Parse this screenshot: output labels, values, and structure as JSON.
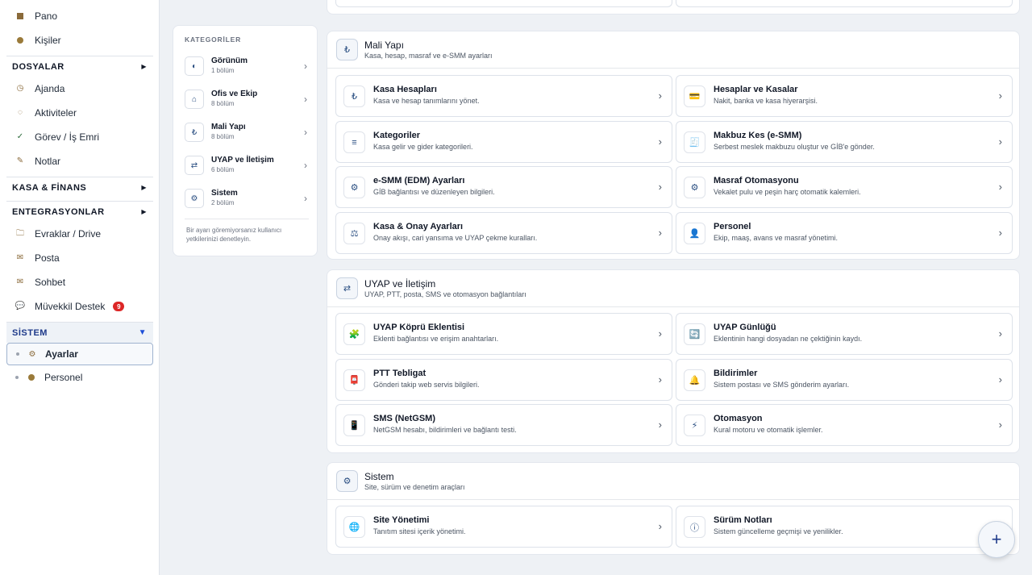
{
  "sidebar": {
    "items_top": [
      {
        "label": "Pano",
        "icon": "dashboard-icon"
      },
      {
        "label": "Kişiler",
        "icon": "contacts-icon"
      }
    ],
    "group_dosyalar": "DOSYALAR",
    "items_dosyalar": [
      {
        "label": "Ajanda",
        "icon": "clock-icon"
      },
      {
        "label": "Aktiviteler",
        "icon": "activity-icon"
      },
      {
        "label": "Görev / İş Emri",
        "icon": "check-icon"
      },
      {
        "label": "Notlar",
        "icon": "pencil-icon"
      }
    ],
    "group_kasa": "KASA & FİNANS",
    "group_entegrasyon": "ENTEGRASYONLAR",
    "items_entegrasyon": [
      {
        "label": "Evraklar / Drive",
        "icon": "folder-icon"
      },
      {
        "label": "Posta",
        "icon": "mail-icon"
      },
      {
        "label": "Sohbet",
        "icon": "chat-icon"
      },
      {
        "label": "Müvekkil Destek",
        "icon": "support-icon",
        "badge": "9"
      }
    ],
    "group_sistem": "SİSTEM",
    "items_sistem": [
      {
        "label": "Ayarlar",
        "icon": "gear-icon",
        "active": true
      },
      {
        "label": "Personel",
        "icon": "person-icon"
      }
    ]
  },
  "categories": {
    "title": "KATEGORİLER",
    "items": [
      {
        "name": "Görünüm",
        "count": "1 bölüm",
        "icon": "◐"
      },
      {
        "name": "Ofis ve Ekip",
        "count": "8 bölüm",
        "icon": "⌂"
      },
      {
        "name": "Mali Yapı",
        "count": "8 bölüm",
        "icon": "₺"
      },
      {
        "name": "UYAP ve İletişim",
        "count": "6 bölüm",
        "icon": "⇄"
      },
      {
        "name": "Sistem",
        "count": "2 bölüm",
        "icon": "⚙"
      }
    ],
    "note": "Bir ayarı göremiyorsanız kullanıcı yetkilerinizi denetleyin."
  },
  "sections": {
    "mali": {
      "title": "Mali Yapı",
      "subtitle": "Kasa, hesap, masraf ve e-SMM ayarları",
      "items": [
        {
          "title": "Kasa Hesapları",
          "desc": "Kasa ve hesap tanımlarını yönet.",
          "icon": "₺"
        },
        {
          "title": "Hesaplar ve Kasalar",
          "desc": "Nakit, banka ve kasa hiyerarşisi.",
          "icon": "💳"
        },
        {
          "title": "Kategoriler",
          "desc": "Kasa gelir ve gider kategorileri.",
          "icon": "≡"
        },
        {
          "title": "Makbuz Kes (e-SMM)",
          "desc": "Serbest meslek makbuzu oluştur ve GİB'e gönder.",
          "icon": "🧾"
        },
        {
          "title": "e-SMM (EDM) Ayarları",
          "desc": "GİB bağlantısı ve düzenleyen bilgileri.",
          "icon": "⚙"
        },
        {
          "title": "Masraf Otomasyonu",
          "desc": "Vekalet pulu ve peşin harç otomatik kalemleri.",
          "icon": "⚙"
        },
        {
          "title": "Kasa & Onay Ayarları",
          "desc": "Onay akışı, cari yansıma ve UYAP çekme kuralları.",
          "icon": "⚖"
        },
        {
          "title": "Personel",
          "desc": "Ekip, maaş, avans ve masraf yönetimi.",
          "icon": "👤"
        }
      ]
    },
    "uyap": {
      "title": "UYAP ve İletişim",
      "subtitle": "UYAP, PTT, posta, SMS ve otomasyon bağlantıları",
      "items": [
        {
          "title": "UYAP Köprü Eklentisi",
          "desc": "Eklenti bağlantısı ve erişim anahtarları.",
          "icon": "🧩"
        },
        {
          "title": "UYAP Günlüğü",
          "desc": "Eklentinin hangi dosyadan ne çektiğinin kaydı.",
          "icon": "🔄"
        },
        {
          "title": "PTT Tebligat",
          "desc": "Gönderi takip web servis bilgileri.",
          "icon": "📮"
        },
        {
          "title": "Bildirimler",
          "desc": "Sistem postası ve SMS gönderim ayarları.",
          "icon": "🔔"
        },
        {
          "title": "SMS (NetGSM)",
          "desc": "NetGSM hesabı, bildirimleri ve bağlantı testi.",
          "icon": "📱"
        },
        {
          "title": "Otomasyon",
          "desc": "Kural motoru ve otomatik işlemler.",
          "icon": "⚡"
        }
      ]
    },
    "sistem": {
      "title": "Sistem",
      "subtitle": "Site, sürüm ve denetim araçları",
      "items": [
        {
          "title": "Site Yönetimi",
          "desc": "Tanıtım sitesi içerik yönetimi.",
          "icon": "🌐"
        },
        {
          "title": "Sürüm Notları",
          "desc": "Sistem güncelleme geçmişi ve yenilikler.",
          "icon": "ⓘ"
        }
      ]
    }
  },
  "fab": {
    "label": "+"
  },
  "colors": {
    "accent": "#1e3a8a",
    "badge": "#dc2626",
    "border": "#dde2ea"
  }
}
